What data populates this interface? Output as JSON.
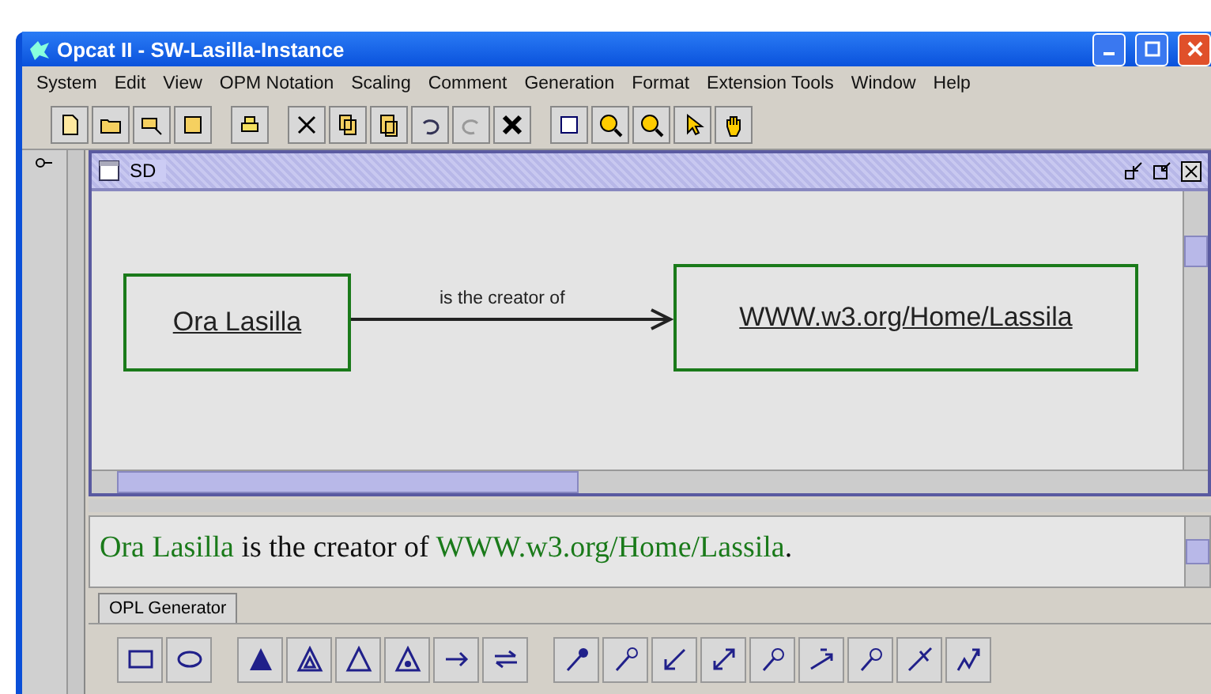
{
  "window": {
    "title": "Opcat II - SW-Lasilla-Instance"
  },
  "menu": [
    "System",
    "Edit",
    "View",
    "OPM Notation",
    "Scaling",
    "Comment",
    "Generation",
    "Format",
    "Extension Tools",
    "Window",
    "Help"
  ],
  "diagram": {
    "title": "SD",
    "objects": [
      {
        "label": "Ora Lasilla"
      },
      {
        "label": "WWW.w3.org/Home/Lassila"
      }
    ],
    "link": {
      "label": "is the creator of"
    }
  },
  "opl": {
    "segments": [
      {
        "text": "Ora Lasilla",
        "kind": "object"
      },
      {
        "text": " is the creator of ",
        "kind": "plain"
      },
      {
        "text": "WWW.w3.org/Home/Lassila",
        "kind": "object"
      },
      {
        "text": ".",
        "kind": "plain"
      }
    ]
  },
  "tabs": [
    {
      "label": "OPL Generator",
      "selected": true
    }
  ]
}
